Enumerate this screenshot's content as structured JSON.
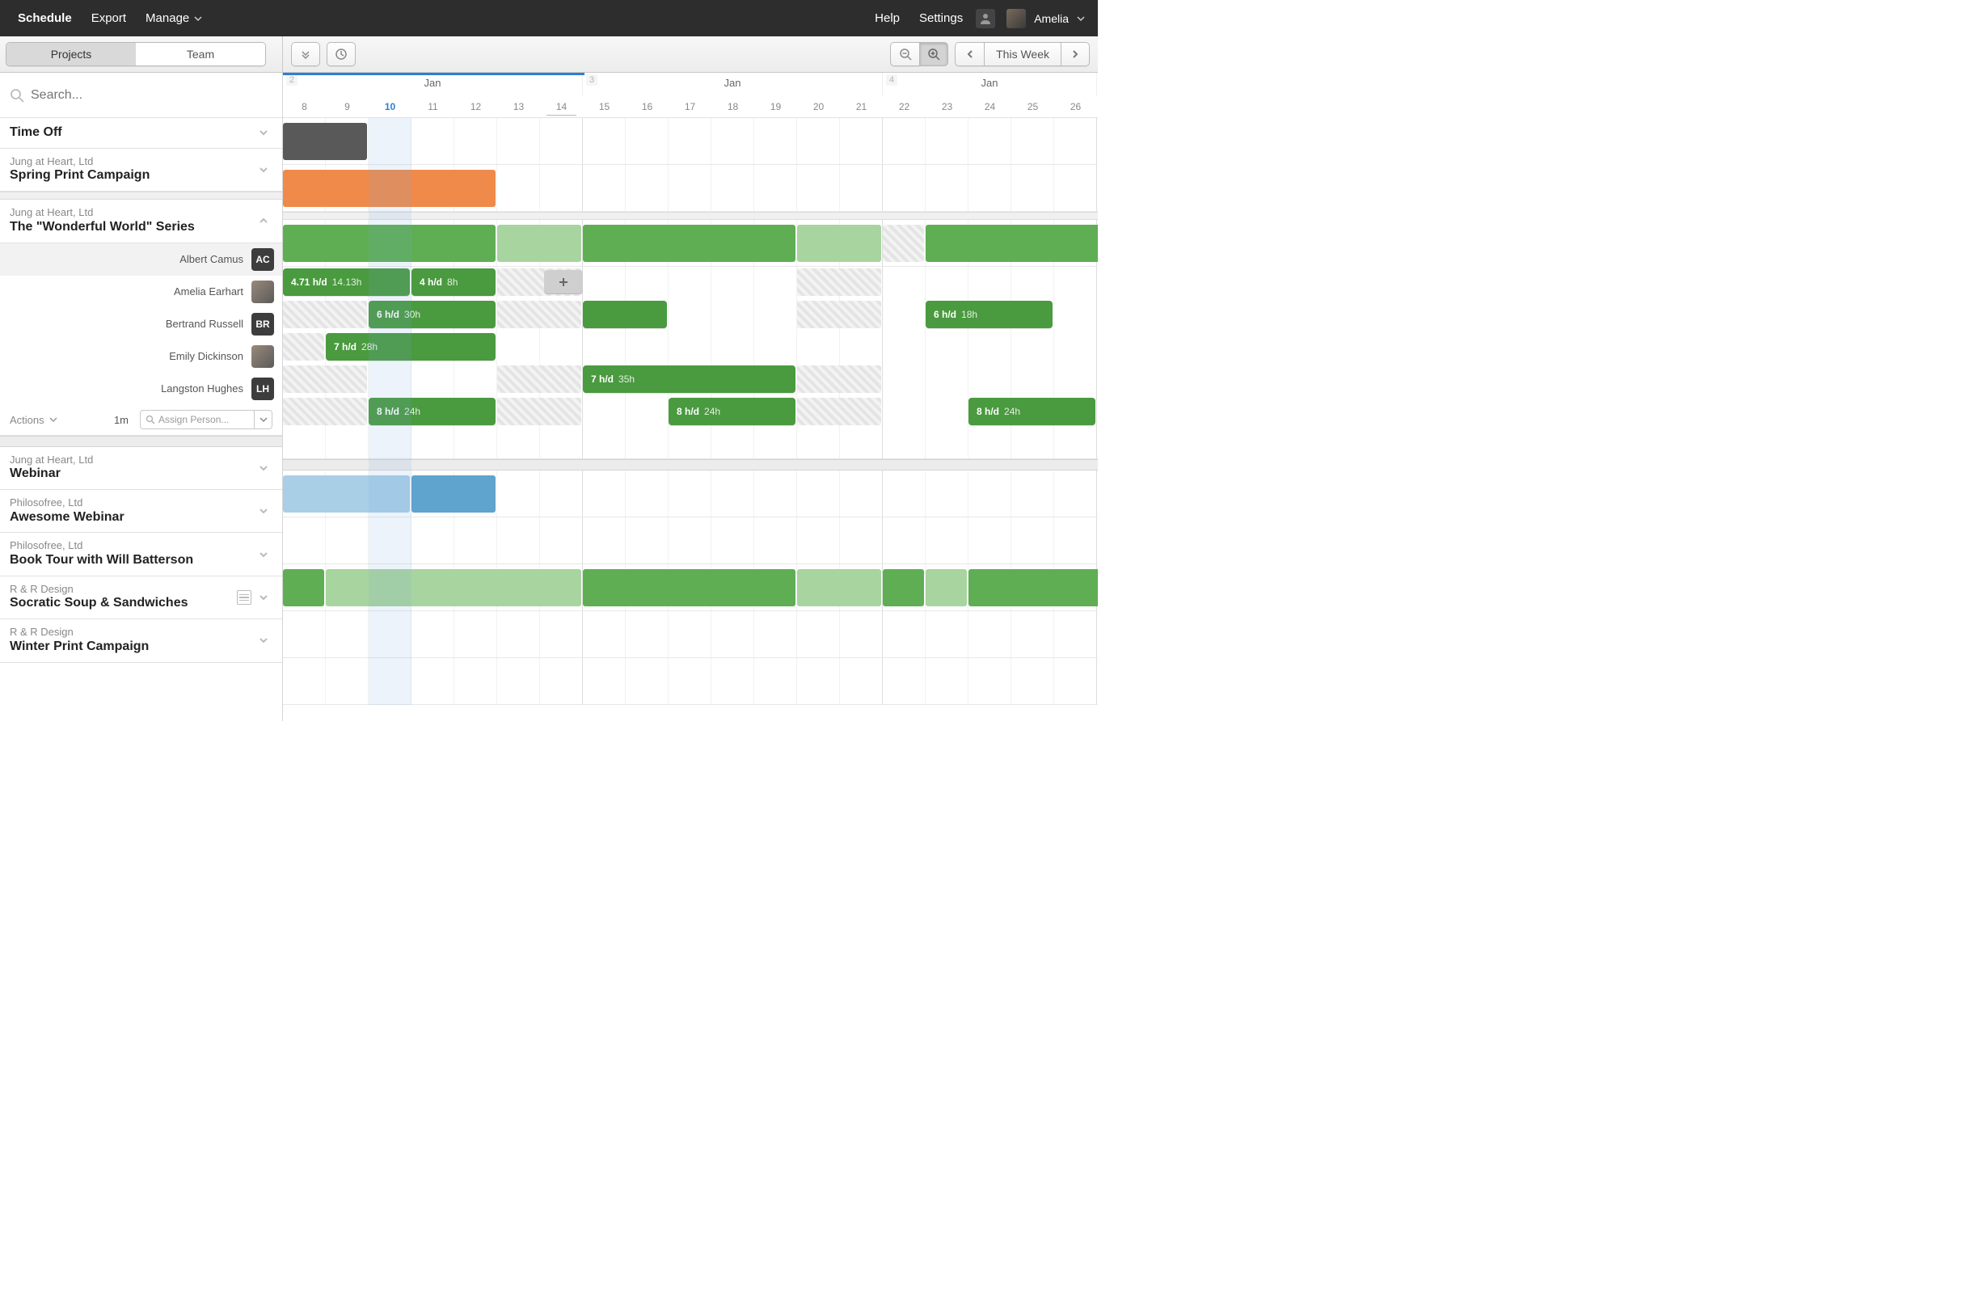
{
  "nav": {
    "schedule": "Schedule",
    "export": "Export",
    "manage": "Manage",
    "help": "Help",
    "settings": "Settings",
    "user": "Amelia"
  },
  "toolbar": {
    "tabs": {
      "projects": "Projects",
      "team": "Team"
    },
    "this_week": "This Week"
  },
  "search": {
    "placeholder": "Search..."
  },
  "timeline": {
    "weeks": [
      {
        "num": "2",
        "month": "Jan",
        "days": [
          "8",
          "9",
          "10",
          "11",
          "12",
          "13",
          "14"
        ],
        "partial_start": true
      },
      {
        "num": "3",
        "month": "Jan",
        "days": [
          "15",
          "16",
          "17",
          "18",
          "19",
          "20",
          "21"
        ]
      },
      {
        "num": "4",
        "month": "Jan",
        "days": [
          "22",
          "23",
          "24",
          "25",
          "26"
        ]
      }
    ],
    "today_index": 2,
    "underline_index": 6,
    "day_width": 53
  },
  "rows": [
    {
      "type": "project",
      "name": "Time Off",
      "client": "",
      "expand": "down",
      "bars": [
        {
          "start": 0,
          "span": 2,
          "cls": "dark"
        }
      ]
    },
    {
      "type": "project",
      "name": "Spring Print Campaign",
      "client": "Jung at Heart, Ltd",
      "expand": "down",
      "bars": [
        {
          "start": 0,
          "span": 5,
          "cls": "orange"
        }
      ]
    },
    {
      "type": "thin-div"
    },
    {
      "type": "project",
      "name": "The \"Wonderful World\" Series",
      "client": "Jung at Heart, Ltd",
      "expand": "up",
      "bars": [
        {
          "start": 0,
          "span": 5,
          "cls": "green"
        },
        {
          "start": 5,
          "span": 2,
          "cls": "green-l"
        },
        {
          "start": 7,
          "span": 5,
          "cls": "green"
        },
        {
          "start": 12,
          "span": 2,
          "cls": "green-l"
        },
        {
          "start": 14,
          "span": 1,
          "cls": "hatch-l"
        },
        {
          "start": 15,
          "span": 5,
          "cls": "green"
        }
      ]
    },
    {
      "type": "person",
      "pname": "Albert Camus",
      "badge": "AC",
      "badge_cls": "dark",
      "hover": true,
      "hatches": [
        {
          "start": 5,
          "span": 2
        },
        {
          "start": 12,
          "span": 2
        }
      ],
      "assignments": [
        {
          "start": 0,
          "span": 3,
          "hd": "4.71 h/d",
          "tot": "14.13h"
        },
        {
          "start": 3,
          "span": 2,
          "hd": "4 h/d",
          "tot": "8h"
        }
      ],
      "add": {
        "start": 6.1
      }
    },
    {
      "type": "person",
      "pname": "Amelia Earhart",
      "badge": "",
      "badge_cls": "photo",
      "hatches": [
        {
          "start": 0,
          "span": 2
        },
        {
          "start": 5,
          "span": 2
        },
        {
          "start": 12,
          "span": 2
        }
      ],
      "assignments": [
        {
          "start": 2,
          "span": 3,
          "hd": "6 h/d",
          "tot": "30h"
        },
        {
          "start": 7,
          "span": 2,
          "hd": "",
          "tot": "",
          "plain": true
        },
        {
          "start": 15,
          "span": 3,
          "hd": "6 h/d",
          "tot": "18h"
        }
      ]
    },
    {
      "type": "person",
      "pname": "Bertrand Russell",
      "badge": "BR",
      "badge_cls": "dark",
      "hatches": [
        {
          "start": 0,
          "span": 1
        }
      ],
      "assignments": [
        {
          "start": 1,
          "span": 4,
          "hd": "7 h/d",
          "tot": "28h"
        }
      ]
    },
    {
      "type": "person",
      "pname": "Emily Dickinson",
      "badge": "",
      "badge_cls": "photo",
      "hatches": [
        {
          "start": 0,
          "span": 2
        },
        {
          "start": 5,
          "span": 2
        },
        {
          "start": 12,
          "span": 2
        }
      ],
      "assignments": [
        {
          "start": 7,
          "span": 5,
          "hd": "7 h/d",
          "tot": "35h"
        }
      ]
    },
    {
      "type": "person",
      "pname": "Langston Hughes",
      "badge": "LH",
      "badge_cls": "dark",
      "hatches": [
        {
          "start": 0,
          "span": 2
        },
        {
          "start": 5,
          "span": 2
        },
        {
          "start": 12,
          "span": 2
        }
      ],
      "assignments": [
        {
          "start": 2,
          "span": 3,
          "hd": "8 h/d",
          "tot": "24h"
        },
        {
          "start": 9,
          "span": 3,
          "hd": "8 h/d",
          "tot": "24h"
        },
        {
          "start": 16,
          "span": 3,
          "hd": "8 h/d",
          "tot": "24h"
        }
      ]
    },
    {
      "type": "footer",
      "actions": "Actions",
      "est": "1m",
      "assign": "Assign Person..."
    },
    {
      "type": "thick-div"
    },
    {
      "type": "project",
      "name": "Webinar",
      "client": "Jung at Heart, Ltd",
      "expand": "down",
      "bars": [
        {
          "start": 0,
          "span": 3,
          "cls": "blue-l"
        },
        {
          "start": 3,
          "span": 2,
          "cls": "blue"
        }
      ]
    },
    {
      "type": "project",
      "name": "Awesome Webinar",
      "client": "Philosofree, Ltd",
      "expand": "down",
      "bars": []
    },
    {
      "type": "project",
      "name": "Book Tour with Will Batterson",
      "client": "Philosofree, Ltd",
      "expand": "down",
      "bars": [
        {
          "start": 0,
          "span": 1,
          "cls": "green"
        },
        {
          "start": 1,
          "span": 6,
          "cls": "green-l"
        },
        {
          "start": 7,
          "span": 5,
          "cls": "green"
        },
        {
          "start": 12,
          "span": 2,
          "cls": "green-l"
        },
        {
          "start": 14,
          "span": 1,
          "cls": "green"
        },
        {
          "start": 15,
          "span": 1,
          "cls": "green-l"
        },
        {
          "start": 16,
          "span": 4,
          "cls": "green"
        }
      ]
    },
    {
      "type": "project",
      "name": "Socratic Soup & Sandwiches",
      "client": "R & R Design",
      "expand": "down",
      "has_notes": true,
      "bars": []
    },
    {
      "type": "project",
      "name": "Winter Print Campaign",
      "client": "R & R Design",
      "expand": "down",
      "bars": []
    }
  ]
}
